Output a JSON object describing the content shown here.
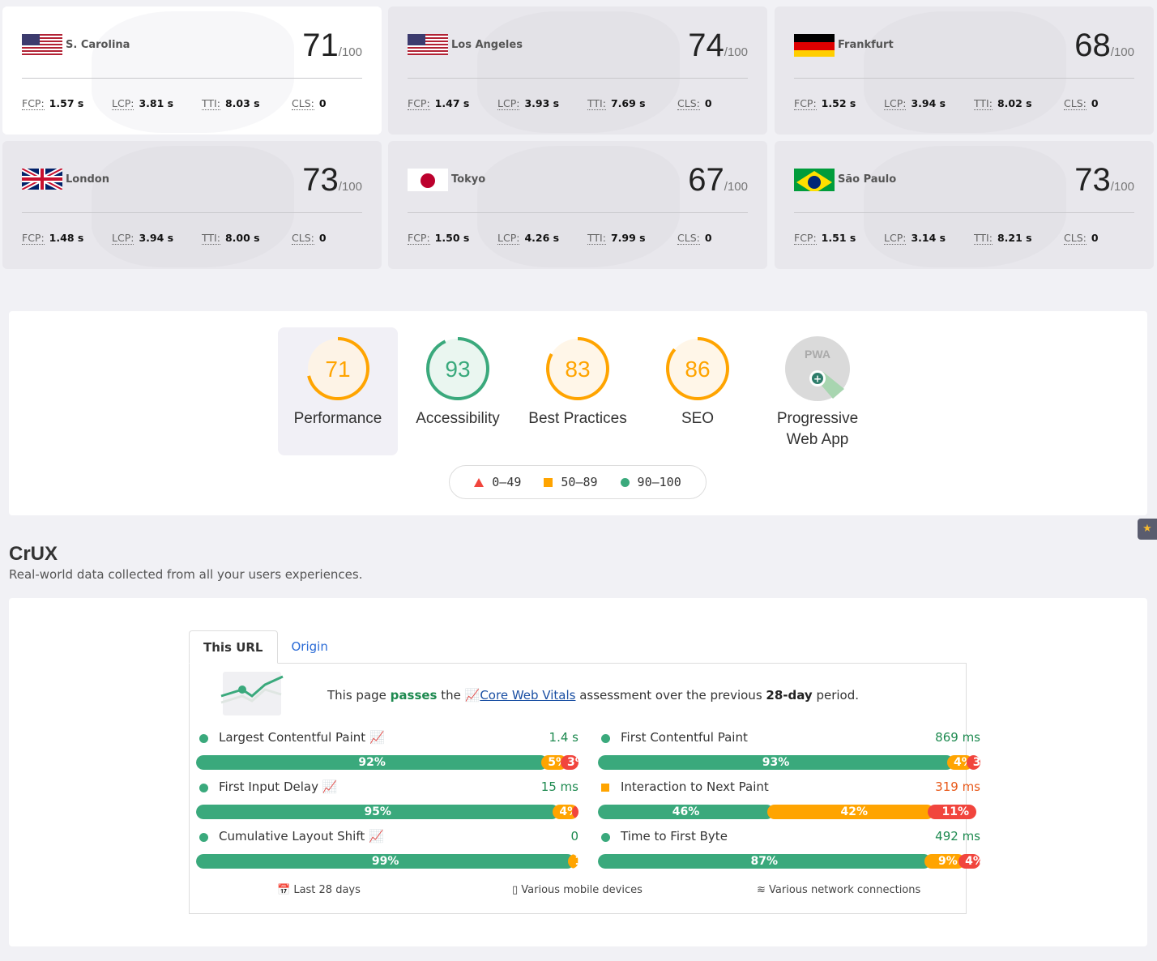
{
  "locations": [
    {
      "city": "S. Carolina",
      "flag": "us",
      "score": "71",
      "max": "/100",
      "fcp": "1.57 s",
      "lcp": "3.81 s",
      "tti": "8.03 s",
      "cls": "0",
      "active": true
    },
    {
      "city": "Los Angeles",
      "flag": "us",
      "score": "74",
      "max": "/100",
      "fcp": "1.47 s",
      "lcp": "3.93 s",
      "tti": "7.69 s",
      "cls": "0"
    },
    {
      "city": "Frankfurt",
      "flag": "de",
      "score": "68",
      "max": "/100",
      "fcp": "1.52 s",
      "lcp": "3.94 s",
      "tti": "8.02 s",
      "cls": "0"
    },
    {
      "city": "London",
      "flag": "gb",
      "score": "73",
      "max": "/100",
      "fcp": "1.48 s",
      "lcp": "3.94 s",
      "tti": "8.00 s",
      "cls": "0"
    },
    {
      "city": "Tokyo",
      "flag": "jp",
      "score": "67",
      "max": "/100",
      "fcp": "1.50 s",
      "lcp": "4.26 s",
      "tti": "7.99 s",
      "cls": "0"
    },
    {
      "city": "São Paulo",
      "flag": "br",
      "score": "73",
      "max": "/100",
      "fcp": "1.51 s",
      "lcp": "3.14 s",
      "tti": "8.21 s",
      "cls": "0"
    }
  ],
  "metric_labels": {
    "fcp": "FCP:",
    "lcp": "LCP:",
    "tti": "TTI:",
    "cls": "CLS:"
  },
  "lighthouse": {
    "gauges": [
      {
        "score": "71",
        "label": "Performance",
        "color": "#ffa400",
        "bg": "#fdf3e6"
      },
      {
        "score": "93",
        "label": "Accessibility",
        "color": "#3aa97c",
        "bg": "#eaf6f0"
      },
      {
        "score": "83",
        "label": "Best Practices",
        "color": "#ffa400",
        "bg": "#fff6e8"
      },
      {
        "score": "86",
        "label": "SEO",
        "color": "#ffa400",
        "bg": "#fff6e8"
      },
      {
        "score": "",
        "label": "Progressive Web App",
        "badge": "PWA",
        "color": "#dadada"
      }
    ],
    "legend": [
      {
        "icon": "triangle",
        "range": "0–49",
        "color": "#f1453d"
      },
      {
        "icon": "square",
        "range": "50–89",
        "color": "#ffa400"
      },
      {
        "icon": "circle",
        "range": "90–100",
        "color": "#3aa97c"
      }
    ]
  },
  "crux": {
    "title": "CrUX",
    "subtitle": "Real-world data collected from all your users experiences.",
    "tabs": [
      "This URL",
      "Origin"
    ],
    "pass": {
      "a": "This page ",
      "b": "passes",
      "c": " the ",
      "link": "Core Web Vitals",
      "d": " assessment over the previous ",
      "e": "28-day",
      "f": " period."
    },
    "metrics": [
      {
        "name": "Largest Contentful Paint",
        "value": "1.4 s",
        "status": "good",
        "chart_icon": true,
        "dist": [
          92,
          5,
          3
        ]
      },
      {
        "name": "First Contentful Paint",
        "value": "869 ms",
        "status": "good",
        "dist": [
          93,
          4,
          3
        ]
      },
      {
        "name": "First Input Delay",
        "value": "15 ms",
        "status": "good",
        "chart_icon": true,
        "dist": [
          95,
          4,
          1
        ]
      },
      {
        "name": "Interaction to Next Paint",
        "value": "319 ms",
        "status": "average",
        "dist": [
          46,
          42,
          11
        ]
      },
      {
        "name": "Cumulative Layout Shift",
        "value": "0",
        "status": "good",
        "chart_icon": true,
        "dist": [
          99,
          1,
          1
        ]
      },
      {
        "name": "Time to First Byte",
        "value": "492 ms",
        "status": "good",
        "dist": [
          87,
          9,
          4
        ]
      }
    ],
    "footer": [
      "Last 28 days",
      "Various mobile devices",
      "Various network connections"
    ]
  },
  "colors": {
    "good": "#3aa97c",
    "average": "#ffa400",
    "poor": "#f1453d",
    "good_text": "#1e8a50",
    "average_text": "#e8591a"
  }
}
